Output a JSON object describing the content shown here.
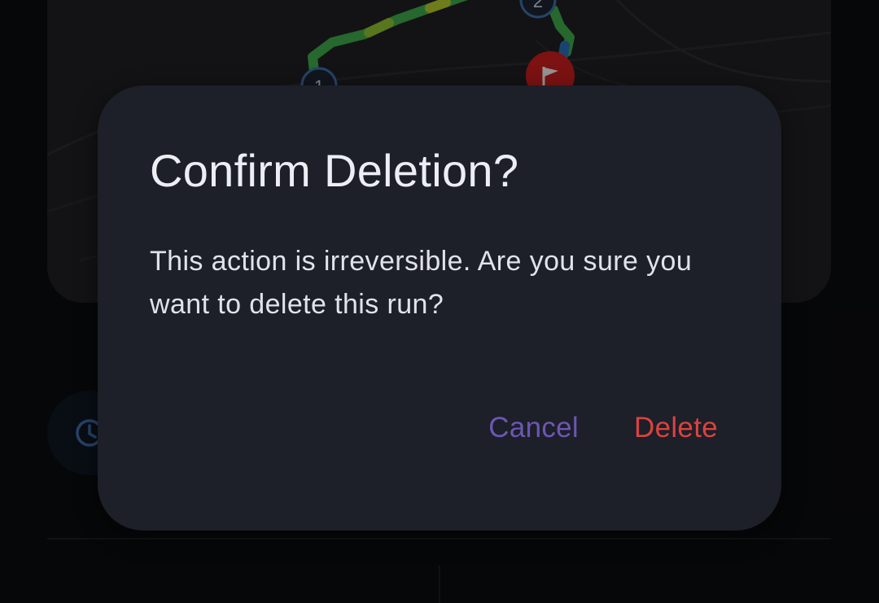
{
  "background": {
    "map_card": {
      "route_markers": [
        "1",
        "2"
      ],
      "finish_icon": "flag-icon"
    },
    "side_button_icon": "clock-icon"
  },
  "dialog": {
    "title": "Confirm Deletion?",
    "message": "This action is irreversible. Are you sure you want to delete this run?",
    "cancel_label": "Cancel",
    "delete_label": "Delete"
  },
  "colors": {
    "dialog_bg": "#1d1f29",
    "cancel": "#6d56b3",
    "delete": "#d9433f",
    "route_green": "#3ea84a",
    "finish_marker": "#c81e1e"
  }
}
